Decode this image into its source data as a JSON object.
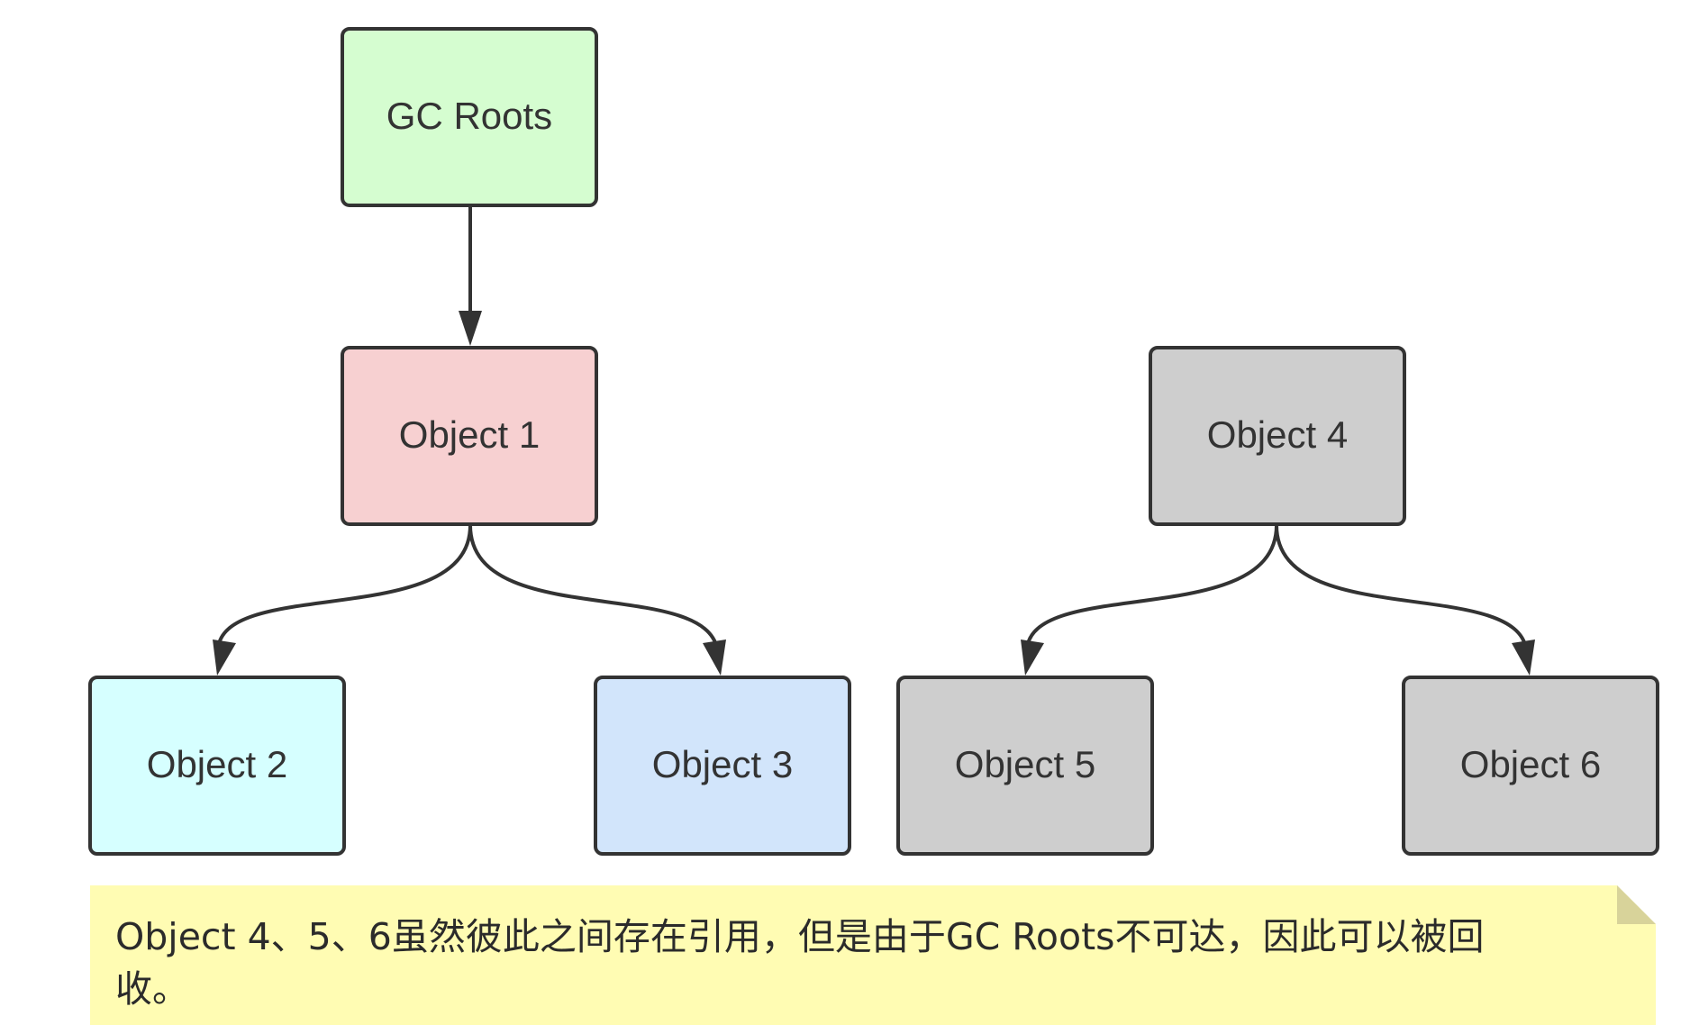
{
  "colors": {
    "gc_roots": "#d5fdd0",
    "object1": "#f7d0d1",
    "object2": "#d6ffff",
    "object3": "#d2e5fb",
    "unreachable": "#cecece",
    "note_bg": "#fffcb3",
    "note_fold": "#d8d39a",
    "stroke": "#333333"
  },
  "nodes": {
    "gc_roots": {
      "label": "GC Roots"
    },
    "object1": {
      "label": "Object 1"
    },
    "object2": {
      "label": "Object 2"
    },
    "object3": {
      "label": "Object 3"
    },
    "object4": {
      "label": "Object 4"
    },
    "object5": {
      "label": "Object 5"
    },
    "object6": {
      "label": "Object 6"
    }
  },
  "edges": [
    {
      "from": "gc_roots",
      "to": "object1"
    },
    {
      "from": "object1",
      "to": "object2"
    },
    {
      "from": "object1",
      "to": "object3"
    },
    {
      "from": "object4",
      "to": "object5"
    },
    {
      "from": "object4",
      "to": "object6"
    }
  ],
  "note": {
    "line1": "Object 4、5、6虽然彼此之间存在引用，但是由于GC Roots不可达，因此可以被回",
    "line2": "收。"
  }
}
